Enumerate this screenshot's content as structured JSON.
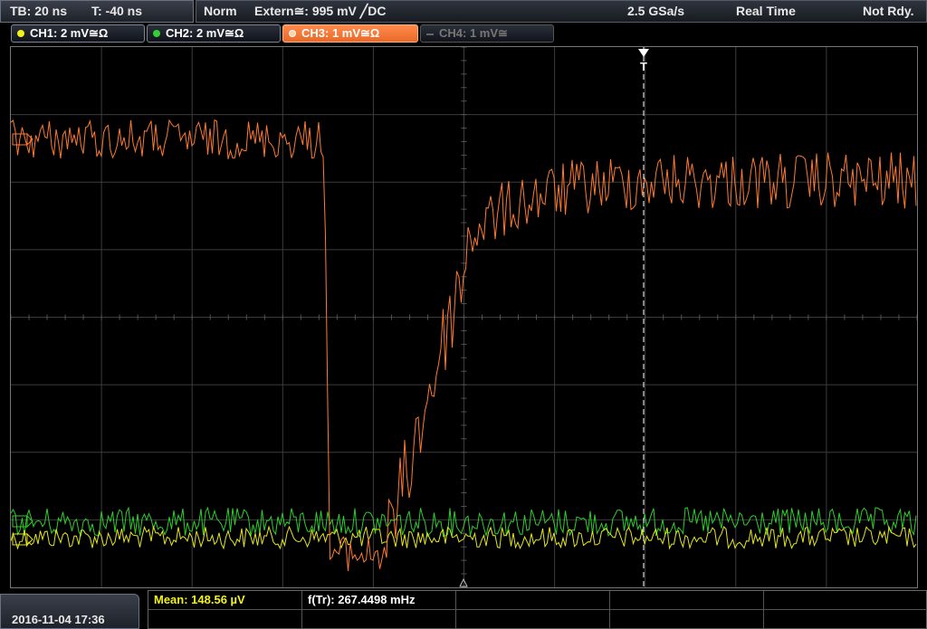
{
  "topbar": {
    "timebase": "TB: 20 ns",
    "trigger_offset": "T: -40 ns",
    "mode": "Norm",
    "trigger": "Extern≅: 995 mV ╱DC",
    "sample_rate": "2.5 GSa/s",
    "acquisition": "Real Time",
    "status": "Not Rdy."
  },
  "channels": [
    {
      "label": "CH1: 2 mV≅Ω",
      "color": "#f2f21a",
      "state": "on"
    },
    {
      "label": "CH2: 2 mV≅Ω",
      "color": "#32d232",
      "state": "on"
    },
    {
      "label": "CH3: 1 mV≅Ω",
      "color": "#ff7a30",
      "state": "active"
    },
    {
      "label": "CH4: 1 mV≅",
      "color": "#666666",
      "state": "off"
    }
  ],
  "trace_colors": {
    "ch1": "#e6e61a",
    "ch2": "#2bd02b",
    "ch3": "#ff7a30"
  },
  "trigger_marker": "T",
  "status_bar": {
    "datetime": "2016-11-04 17:36",
    "mean": "Mean: 148.56 µV",
    "freq": "f(Tr): 267.4498 mHz"
  }
}
